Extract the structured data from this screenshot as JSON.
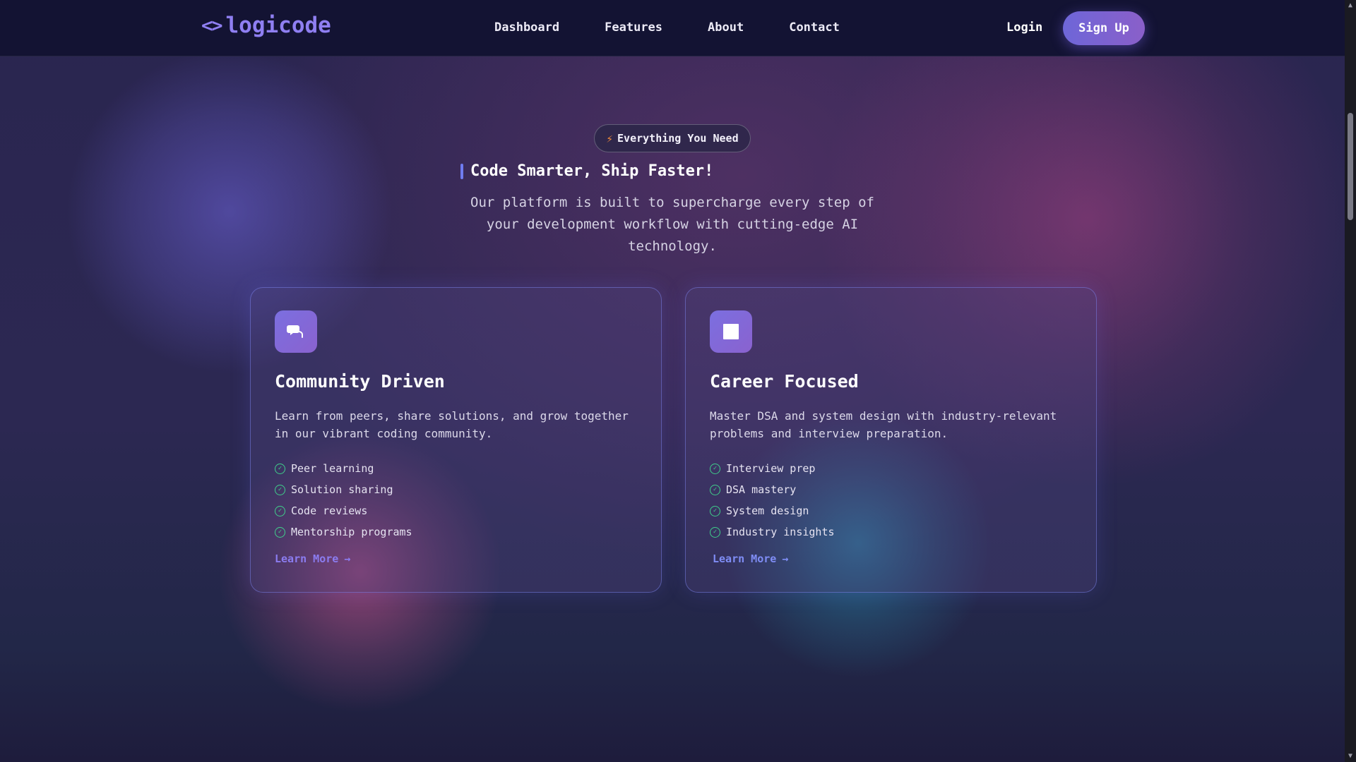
{
  "nav": {
    "logo_icon": "<>",
    "logo_text": "logicode",
    "links": [
      "Dashboard",
      "Features",
      "About",
      "Contact"
    ],
    "login": "Login",
    "signup": "Sign Up"
  },
  "hero": {
    "badge": "Everything You Need",
    "heading": "Code Smarter, Ship Faster!",
    "subtitle": "Our platform is built to supercharge every step of your development workflow with cutting-edge AI technology."
  },
  "cards": [
    {
      "icon": "chat-bubbles-icon",
      "title": "Community Driven",
      "description": "Learn from peers, share solutions, and grow together in our vibrant coding community.",
      "features": [
        "Peer learning",
        "Solution sharing",
        "Code reviews",
        "Mentorship programs"
      ],
      "cta": "Learn More"
    },
    {
      "icon": "square-icon",
      "title": "Career Focused",
      "description": "Master DSA and system design with industry-relevant problems and interview preparation.",
      "features": [
        "Interview prep",
        "DSA mastery",
        "System design",
        "Industry insights"
      ],
      "cta": "Learn More"
    }
  ],
  "colors": {
    "accent": "#8f7ff2",
    "nav_bg": "#131333",
    "check": "#3fd08b",
    "bolt": "#f08a3c"
  }
}
